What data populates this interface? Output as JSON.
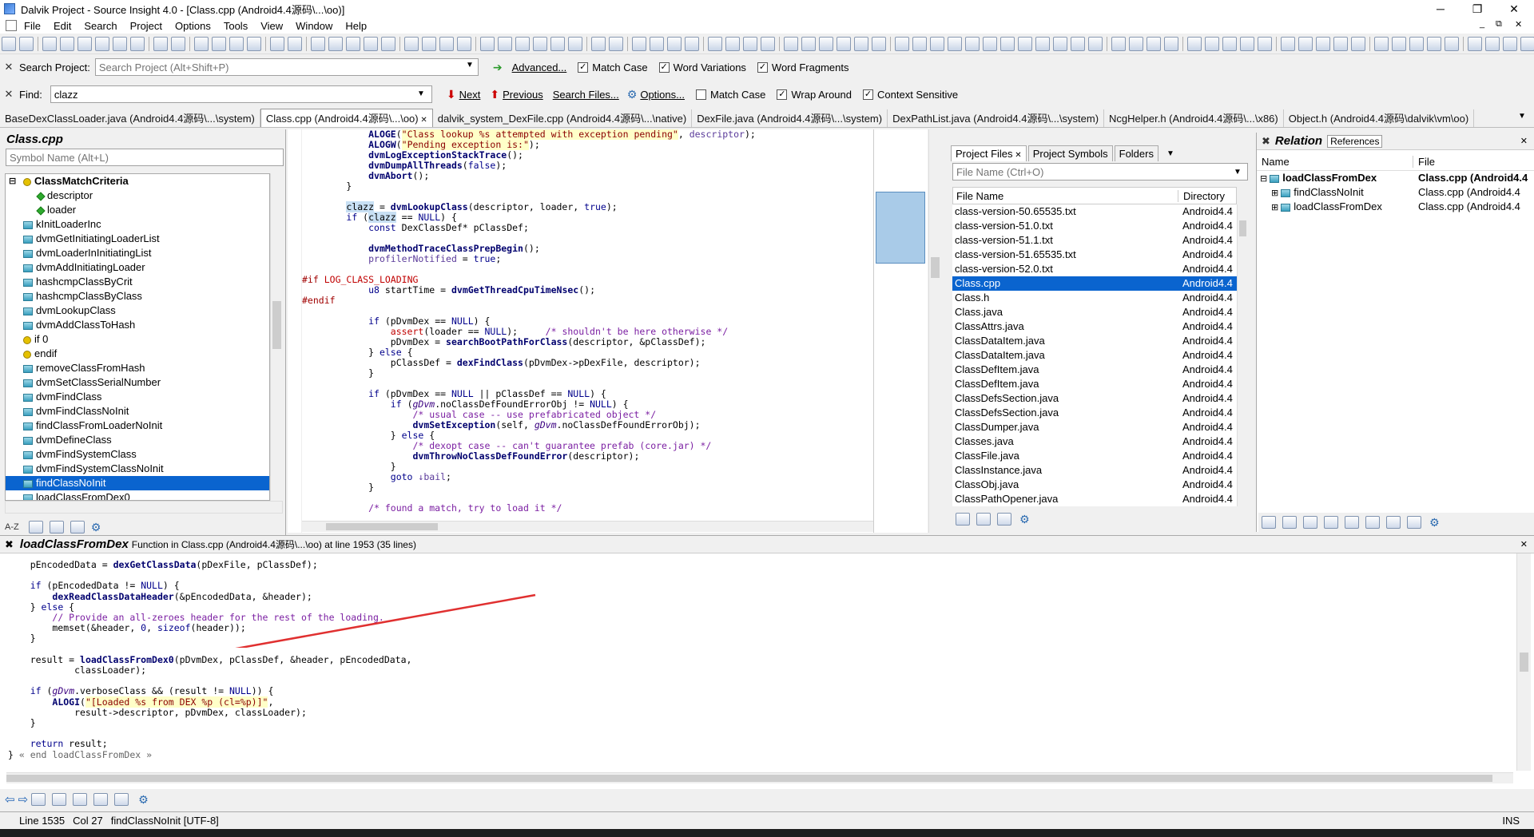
{
  "window": {
    "title": "Dalvik Project - Source Insight 4.0 - [Class.cpp (Android4.4源码\\...\\oo)]",
    "minimize": "─",
    "maximize": "❐",
    "close": "✕",
    "inner_restore": "⧉",
    "inner_close": "✕"
  },
  "menu": [
    "File",
    "Edit",
    "Search",
    "Project",
    "Options",
    "Tools",
    "View",
    "Window",
    "Help"
  ],
  "search_project": {
    "label": "Search Project:",
    "placeholder": "Search Project (Alt+Shift+P)",
    "advanced": "Advanced...",
    "match_case": "Match Case",
    "word_variations": "Word Variations",
    "word_fragments": "Word Fragments"
  },
  "find": {
    "label": "Find:",
    "value": "clazz",
    "next": "Next",
    "previous": "Previous",
    "search_files": "Search Files...",
    "options": "Options...",
    "match_case": "Match Case",
    "wrap_around": "Wrap Around",
    "context_sensitive": "Context Sensitive"
  },
  "tabs": [
    "BaseDexClassLoader.java (Android4.4源码\\...\\system)",
    "Class.cpp (Android4.4源码\\...\\oo)",
    "dalvik_system_DexFile.cpp (Android4.4源码\\...\\native)",
    "DexFile.java (Android4.4源码\\...\\system)",
    "DexPathList.java (Android4.4源码\\...\\system)",
    "NcgHelper.h (Android4.4源码\\...\\x86)",
    "Object.h (Android4.4源码\\dalvik\\vm\\oo)"
  ],
  "symbol_panel": {
    "title": "Class.cpp",
    "placeholder": "Symbol Name (Alt+L)",
    "items": [
      "ClassMatchCriteria",
      "descriptor",
      "loader",
      "kInitLoaderInc",
      "dvmGetInitiatingLoaderList",
      "dvmLoaderInInitiatingList",
      "dvmAddInitiatingLoader",
      "hashcmpClassByCrit",
      "hashcmpClassByClass",
      "dvmLookupClass",
      "dvmAddClassToHash",
      "if 0",
      "endif",
      "removeClassFromHash",
      "dvmSetClassSerialNumber",
      "dvmFindClass",
      "dvmFindClassNoInit",
      "findClassFromLoaderNoInit",
      "dvmDefineClass",
      "dvmFindSystemClass",
      "dvmFindSystemClassNoInit",
      "findClassNoInit",
      "loadClassFromDex0"
    ],
    "sort_label": "A-Z"
  },
  "files_panel": {
    "tabs": [
      "Project Files",
      "Project Symbols",
      "Folders"
    ],
    "placeholder": "File Name (Ctrl+O)",
    "col_name": "File Name",
    "col_dir": "Directory",
    "rows": [
      [
        "class-version-50.65535.txt",
        "Android4.4"
      ],
      [
        "class-version-51.0.txt",
        "Android4.4"
      ],
      [
        "class-version-51.1.txt",
        "Android4.4"
      ],
      [
        "class-version-51.65535.txt",
        "Android4.4"
      ],
      [
        "class-version-52.0.txt",
        "Android4.4"
      ],
      [
        "Class.cpp",
        "Android4.4"
      ],
      [
        "Class.h",
        "Android4.4"
      ],
      [
        "Class.java",
        "Android4.4"
      ],
      [
        "ClassAttrs.java",
        "Android4.4"
      ],
      [
        "ClassDataItem.java",
        "Android4.4"
      ],
      [
        "ClassDataItem.java",
        "Android4.4"
      ],
      [
        "ClassDefItem.java",
        "Android4.4"
      ],
      [
        "ClassDefItem.java",
        "Android4.4"
      ],
      [
        "ClassDefsSection.java",
        "Android4.4"
      ],
      [
        "ClassDefsSection.java",
        "Android4.4"
      ],
      [
        "ClassDumper.java",
        "Android4.4"
      ],
      [
        "Classes.java",
        "Android4.4"
      ],
      [
        "ClassFile.java",
        "Android4.4"
      ],
      [
        "ClassInstance.java",
        "Android4.4"
      ],
      [
        "ClassObj.java",
        "Android4.4"
      ],
      [
        "ClassPathOpener.java",
        "Android4.4"
      ]
    ]
  },
  "relation_panel": {
    "title": "Relation",
    "tab": "References",
    "col_name": "Name",
    "col_file": "File",
    "rows": [
      [
        "loadClassFromDex",
        "Class.cpp (Android4.4"
      ],
      [
        "findClassNoInit",
        "Class.cpp (Android4.4"
      ],
      [
        "loadClassFromDex",
        "Class.cpp (Android4.4"
      ]
    ]
  },
  "context_panel": {
    "symbol": "loadClassFromDex",
    "info": "Function in Class.cpp (Android4.4源码\\...\\oo) at line 1953 (35 lines)"
  },
  "status": {
    "line": "Line 1535",
    "col": "Col 27",
    "symbol": "findClassNoInit [UTF-8]",
    "mode": "INS"
  },
  "colors": {
    "selection": "#0a64cf",
    "arrow": "#e03030"
  }
}
